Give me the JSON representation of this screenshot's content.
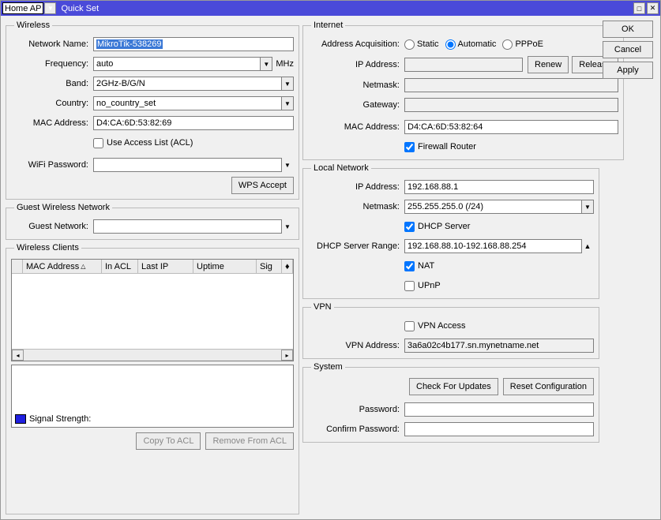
{
  "titlebar": {
    "mode": "Home AP",
    "title": "Quick Set"
  },
  "buttons": {
    "ok": "OK",
    "cancel": "Cancel",
    "apply": "Apply"
  },
  "wireless": {
    "legend": "Wireless",
    "network_name_lbl": "Network Name:",
    "network_name": "MikroTik-538269",
    "frequency_lbl": "Frequency:",
    "frequency": "auto",
    "frequency_unit": "MHz",
    "band_lbl": "Band:",
    "band": "2GHz-B/G/N",
    "country_lbl": "Country:",
    "country": "no_country_set",
    "mac_lbl": "MAC Address:",
    "mac": "D4:CA:6D:53:82:69",
    "use_acl_lbl": "Use Access List (ACL)",
    "wifi_pw_lbl": "WiFi Password:",
    "wifi_pw": "",
    "wps_btn": "WPS Accept"
  },
  "guest": {
    "legend": "Guest Wireless Network",
    "guest_lbl": "Guest Network:",
    "guest": ""
  },
  "clients": {
    "legend": "Wireless Clients",
    "cols": [
      "",
      "MAC Address",
      "In ACL",
      "Last IP",
      "Uptime",
      "Sig"
    ],
    "signal_lbl": "Signal Strength:",
    "copy_btn": "Copy To ACL",
    "remove_btn": "Remove From ACL"
  },
  "internet": {
    "legend": "Internet",
    "acq_lbl": "Address Acquisition:",
    "acq_opts": [
      "Static",
      "Automatic",
      "PPPoE"
    ],
    "acq_sel": "Automatic",
    "ip_lbl": "IP Address:",
    "ip": "",
    "renew_btn": "Renew",
    "release_btn": "Release",
    "netmask_lbl": "Netmask:",
    "netmask": "",
    "gateway_lbl": "Gateway:",
    "gateway": "",
    "mac_lbl": "MAC Address:",
    "mac": "D4:CA:6D:53:82:64",
    "fw_lbl": "Firewall Router"
  },
  "local": {
    "legend": "Local Network",
    "ip_lbl": "IP Address:",
    "ip": "192.168.88.1",
    "netmask_lbl": "Netmask:",
    "netmask": "255.255.255.0 (/24)",
    "dhcp_lbl": "DHCP Server",
    "range_lbl": "DHCP Server Range:",
    "range": "192.168.88.10-192.168.88.254",
    "nat_lbl": "NAT",
    "upnp_lbl": "UPnP"
  },
  "vpn": {
    "legend": "VPN",
    "access_lbl": "VPN Access",
    "addr_lbl": "VPN Address:",
    "addr": "3a6a02c4b177.sn.mynetname.net"
  },
  "system": {
    "legend": "System",
    "check_btn": "Check For Updates",
    "reset_btn": "Reset Configuration",
    "pw_lbl": "Password:",
    "cpw_lbl": "Confirm Password:"
  }
}
